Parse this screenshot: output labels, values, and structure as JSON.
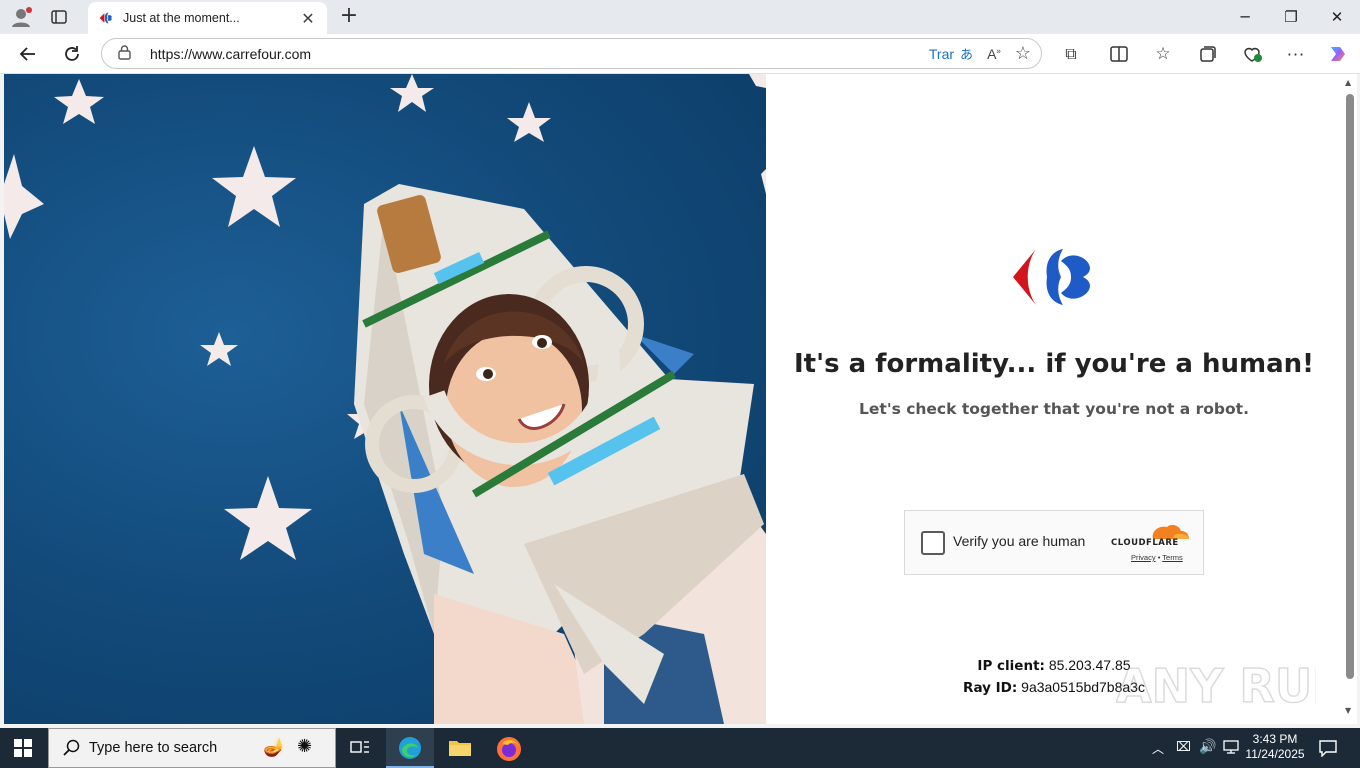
{
  "browser": {
    "tab_title": "Just at the moment...",
    "url": "https://www.carrefour.com",
    "translate_label": "Trar"
  },
  "page": {
    "heading": "It's a formality... if you're a human!",
    "subheading": "Let's check together that you're not a robot.",
    "captcha": {
      "label": "Verify you are human",
      "brand": "CLOUDFLARE",
      "privacy": "Privacy",
      "separator": "•",
      "terms": "Terms"
    },
    "ip_label": "IP client:",
    "ip_value": "85.203.47.85",
    "ray_label": "Ray ID:",
    "ray_value": "9a3a0515bd7b8a3c",
    "watermark": "ANY RUN"
  },
  "taskbar": {
    "search_placeholder": "Type here to search",
    "time": "3:43 PM",
    "date": "11/24/2025"
  },
  "colors": {
    "carrefour_blue": "#1e5bc6",
    "carrefour_red": "#d4141c",
    "cloudflare_orange": "#f48120"
  }
}
